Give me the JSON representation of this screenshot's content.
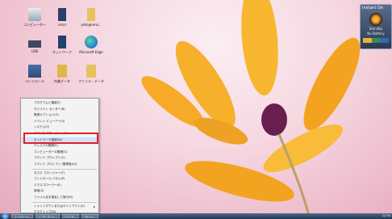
{
  "desktop": {
    "icons": [
      {
        "label": "コンピューター",
        "icon": "recycle-bin-icon"
      },
      {
        "label": "sena",
        "icon": "user-folder-icon"
      },
      {
        "label": "yokogoeno...",
        "icon": "folder-icon"
      },
      {
        "label": "USB",
        "icon": "drive-icon"
      },
      {
        "label": "ネットワーク",
        "icon": "network-folder-icon"
      },
      {
        "label": "Microsoft Edge",
        "icon": "edge-icon"
      },
      {
        "label": "コントロール",
        "icon": "control-panel-icon"
      },
      {
        "label": "作業データ",
        "icon": "data-folder-icon"
      },
      {
        "label": "ファイル・データ",
        "icon": "music-folder-icon"
      }
    ],
    "gadget": {
      "title": "Instant On",
      "status_line1": "Standby",
      "status_line2": "No Battery"
    }
  },
  "context_menu": {
    "items": [
      {
        "label": "プログラムと機能(F)",
        "type": "item"
      },
      {
        "label": "モビリティ センター(B)",
        "type": "item"
      },
      {
        "label": "電源オプション(O)",
        "type": "item"
      },
      {
        "label": "イベント ビューアー(V)",
        "type": "item"
      },
      {
        "label": "システム(Y)",
        "type": "item"
      },
      {
        "label": "デバイス マネージャー(M)",
        "type": "item"
      },
      {
        "label": "ネットワーク接続(W)",
        "type": "item",
        "highlighted": true
      },
      {
        "label": "ディスクの管理(K)",
        "type": "item"
      },
      {
        "label": "コンピューターの管理(G)",
        "type": "item"
      },
      {
        "label": "コマンド プロンプト(C)",
        "type": "item"
      },
      {
        "label": "コマンド プロンプト (管理者)(A)",
        "type": "item"
      },
      {
        "type": "separator"
      },
      {
        "label": "タスク マネージャー(T)",
        "type": "item"
      },
      {
        "label": "コントロール パネル(P)",
        "type": "item"
      },
      {
        "label": "エクスプローラー(E)",
        "type": "item"
      },
      {
        "label": "検索(S)",
        "type": "item"
      },
      {
        "label": "ファイル名を指定して実行(R)",
        "type": "item"
      },
      {
        "type": "separator"
      },
      {
        "label": "シャットダウンまたはサインアウト(U)",
        "type": "item",
        "submenu": true
      },
      {
        "label": "デスクトップ(D)",
        "type": "item"
      }
    ]
  },
  "taskbar": {
    "buttons": [
      "コントロール...",
      "インターネット...",
      "ファイル...",
      "コマンド..."
    ],
    "clock": "12:34"
  },
  "colors": {
    "highlight_border": "#e0202a",
    "petal": "#f6a21e",
    "flower_center": "#6a1e4f"
  }
}
